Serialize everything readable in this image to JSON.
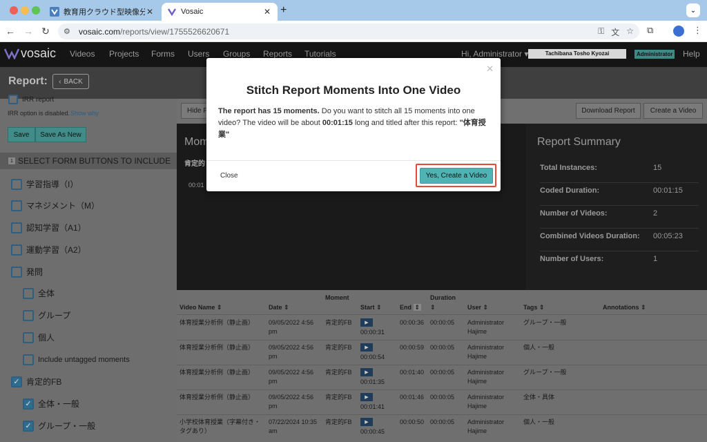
{
  "browser": {
    "tabs": [
      {
        "title": "教育用クラウド型映像分析ソフト"
      },
      {
        "title": "Vosaic"
      }
    ],
    "url_host": "vosaic.com",
    "url_path": "/reports/view/1755526620671"
  },
  "app": {
    "logo_text": "vosaic",
    "nav": [
      "Videos",
      "Projects",
      "Forms",
      "Users",
      "Groups",
      "Reports",
      "Tutorials"
    ],
    "greeting": "Hi, Administrator",
    "org_name": "Tachibana Tosho Kyozai",
    "role_badge": "Administrator",
    "help": "Help"
  },
  "report_bar": {
    "title": "Report:",
    "back": "BACK"
  },
  "sidebar": {
    "irr_report": "IRR report",
    "irr_disabled": "IRR option is disabled.",
    "show_why": "Show why",
    "save": "Save",
    "save_as_new": "Save As New",
    "section_num": "1",
    "section_title": "SELECT FORM BUTTONS TO INCLUDE",
    "items": [
      {
        "label": "学習指導（I）",
        "checked": false
      },
      {
        "label": "マネジメント（M）",
        "checked": false
      },
      {
        "label": "認知学習（A1）",
        "checked": false
      },
      {
        "label": "運動学習（A2）",
        "checked": false
      },
      {
        "label": "発問",
        "checked": false
      },
      {
        "label": "全体",
        "checked": false
      },
      {
        "label": "グループ",
        "checked": false
      },
      {
        "label": "個人",
        "checked": false
      },
      {
        "label": "Include untagged moments",
        "checked": false
      },
      {
        "label": "肯定的FB",
        "checked": true
      },
      {
        "label": "全体・一般",
        "checked": true
      },
      {
        "label": "グループ・一般",
        "checked": true
      }
    ]
  },
  "main": {
    "hide_btn": "Hide F",
    "download_report": "Download Report",
    "create_video": "Create a Video",
    "moments_title": "Mom",
    "moments_sub": "肯定的",
    "moments_time": "00:01"
  },
  "summary": {
    "title": "Report Summary",
    "rows": [
      {
        "label": "Total Instances:",
        "value": "15"
      },
      {
        "label": "Coded Duration:",
        "value": "00:01:15"
      },
      {
        "label": "Number of Videos:",
        "value": "2"
      },
      {
        "label": "Combined Videos Duration:",
        "value": "00:05:23"
      },
      {
        "label": "Number of Users:",
        "value": "1"
      }
    ]
  },
  "table": {
    "headers": {
      "video_name": "Video Name ⇕",
      "date": "Date ⇕",
      "moment": "Moment",
      "start": "Start ⇕",
      "end": "End",
      "duration": "Duration",
      "duration_sort": "⇕",
      "user": "User ⇕",
      "tags": "Tags ⇕",
      "annotations": "Annotations ⇕"
    },
    "rows": [
      {
        "video": "体育授業分析例（静止画）",
        "date1": "09/05/2022 4:56",
        "date2": "pm",
        "moment": "肯定的FB",
        "start": "00:00:31",
        "end": "00:00:36",
        "duration": "00:00:05",
        "user1": "Administrator",
        "user2": "Hajime",
        "tags": "グループ・一般"
      },
      {
        "video": "体育授業分析例（静止画）",
        "date1": "09/05/2022 4:56",
        "date2": "pm",
        "moment": "肯定的FB",
        "start": "00:00:54",
        "end": "00:00:59",
        "duration": "00:00:05",
        "user1": "Administrator",
        "user2": "Hajime",
        "tags": "個人・一般"
      },
      {
        "video": "体育授業分析例（静止画）",
        "date1": "09/05/2022 4:56",
        "date2": "pm",
        "moment": "肯定的FB",
        "start": "00:01:35",
        "end": "00:01:40",
        "duration": "00:00:05",
        "user1": "Administrator",
        "user2": "Hajime",
        "tags": "グループ・一般"
      },
      {
        "video": "体育授業分析例（静止画）",
        "date1": "09/05/2022 4:56",
        "date2": "pm",
        "moment": "肯定的FB",
        "start": "00:01:41",
        "end": "00:01:46",
        "duration": "00:00:05",
        "user1": "Administrator",
        "user2": "Hajime",
        "tags": "全体・具体"
      },
      {
        "video": "小学校体育授業（字幕付き・",
        "video2": "タグあり）",
        "date1": "07/22/2024 10:35",
        "date2": "am",
        "moment": "肯定的FB",
        "start": "00:00:45",
        "end": "00:00:50",
        "duration": "00:00:05",
        "user1": "Administrator",
        "user2": "Hajime",
        "tags": "個人・一般"
      }
    ]
  },
  "modal": {
    "title": "Stitch Report Moments Into One Video",
    "body_bold1": "The report has 15 moments.",
    "body_text1": " Do you want to stitch all 15 moments into one video? The video will be about ",
    "body_bold2": "00:01:15",
    "body_text2": " long and titled after this report: ",
    "body_bold3": "\"体育授業\"",
    "close": "Close",
    "confirm": "Yes, Create a Video"
  }
}
